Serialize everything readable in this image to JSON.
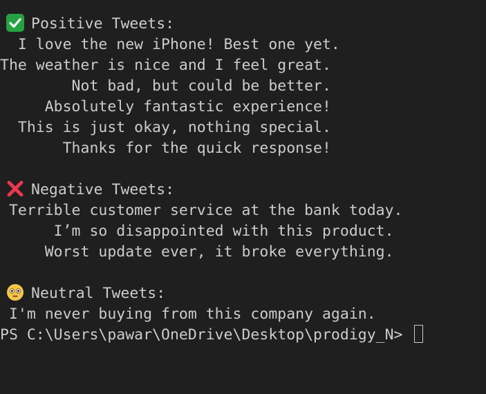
{
  "terminal": {
    "positive": {
      "heading": "Positive Tweets:",
      "icon": "check-mark-icon",
      "lines": [
        "  I love the new iPhone! Best one yet.",
        "The weather is nice and I feel great.",
        "        Not bad, but could be better.",
        "     Absolutely fantastic experience!",
        "  This is just okay, nothing special.",
        "       Thanks for the quick response!"
      ]
    },
    "negative": {
      "heading": "Negative Tweets:",
      "icon": "cross-mark-icon",
      "lines": [
        " Terrible customer service at the bank today.",
        "      I’m so disappointed with this product.",
        "     Worst update ever, it broke everything."
      ]
    },
    "neutral": {
      "heading": "Neutral Tweets:",
      "icon": "flushed-face-icon",
      "lines": [
        " I'm never buying from this company again."
      ]
    },
    "prompt": "PS C:\\Users\\pawar\\OneDrive\\Desktop\\prodigy_N> "
  },
  "colors": {
    "background": "#1f1f1f",
    "text": "#cccccc",
    "check_green": "#27a243",
    "cross_red": "#e8394f",
    "face_yellow": "#f7c548"
  }
}
